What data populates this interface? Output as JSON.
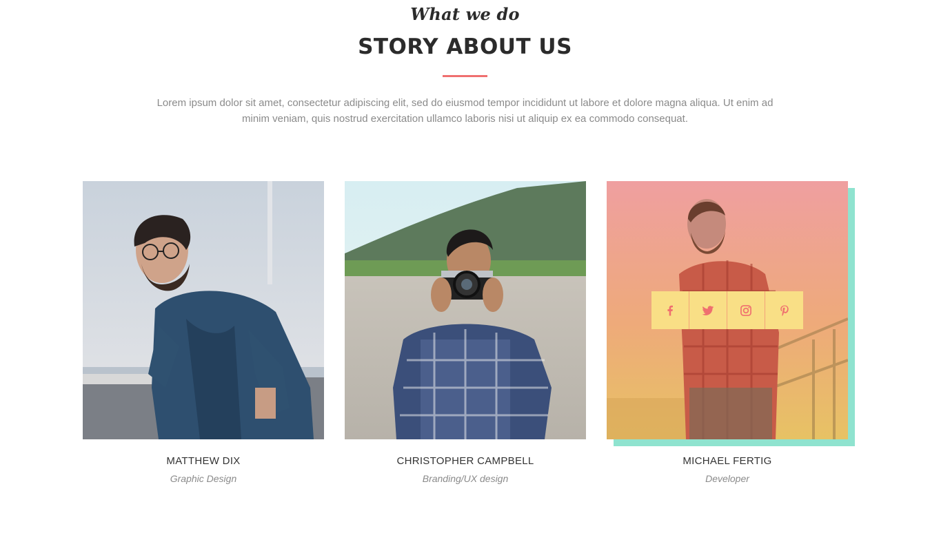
{
  "header": {
    "eyebrow": "What we do",
    "title": "STORY ABOUT US",
    "intro": "Lorem ipsum dolor sit amet, consectetur adipiscing elit, sed do eiusmod tempor incididunt ut labore et dolore magna aliqua. Ut enim ad minim veniam, quis nostrud exercitation ullamco laboris nisi ut aliquip ex ea commodo consequat."
  },
  "colors": {
    "accent": "#ef6f6f",
    "teal": "#8fe3cf",
    "social_bg": "#f9df86",
    "heading": "#2b2b2b",
    "muted": "#8a8a8a"
  },
  "team": [
    {
      "name": "MATTHEW DIX",
      "role": "Graphic Design",
      "photo": "man-in-denim-shirt-photo"
    },
    {
      "name": "CHRISTOPHER CAMPBELL",
      "role": "Branding/UX design",
      "photo": "man-with-camera-photo"
    },
    {
      "name": "MICHAEL FERTIG",
      "role": "Developer",
      "photo": "man-in-plaid-shirt-photo"
    }
  ],
  "social_icons": [
    "facebook-icon",
    "twitter-icon",
    "instagram-icon",
    "pinterest-icon"
  ]
}
